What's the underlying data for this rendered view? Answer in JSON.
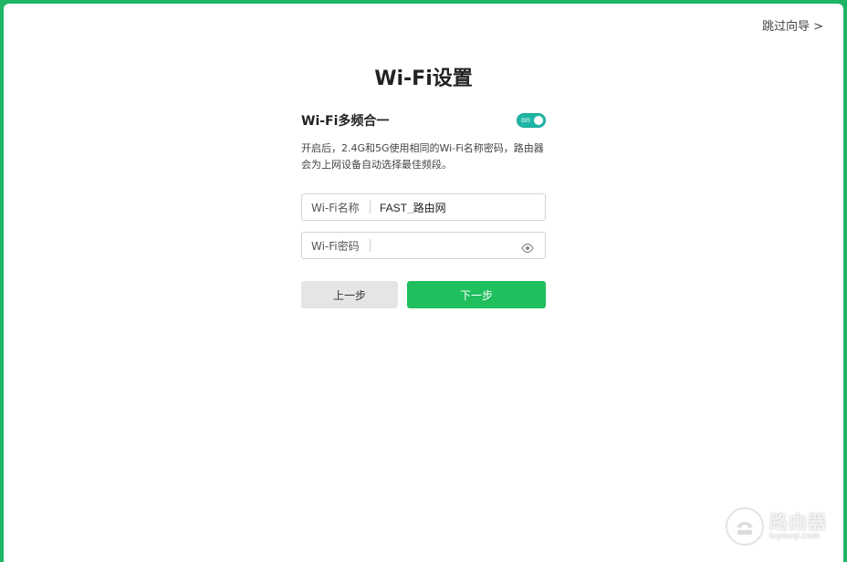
{
  "header": {
    "skip_label": "跳过向导 >"
  },
  "page": {
    "title": "Wi-Fi设置"
  },
  "wifi_merge": {
    "title": "Wi-Fi多频合一",
    "toggle_text": "on",
    "toggle_state": true,
    "description": "开启后，2.4G和5G使用相同的Wi-Fi名称密码，路由器会为上网设备自动选择最佳频段。"
  },
  "fields": {
    "name_label": "Wi-Fi名称",
    "name_value": "FAST_路由网",
    "password_label": "Wi-Fi密码",
    "password_value": ""
  },
  "buttons": {
    "prev_label": "上一步",
    "next_label": "下一步"
  },
  "watermark": {
    "text": "路由器",
    "sub": "luyouqi.com"
  },
  "colors": {
    "accent": "#1fbf5e",
    "toggle": "#1fb6a6",
    "frame": "#1fb463"
  }
}
